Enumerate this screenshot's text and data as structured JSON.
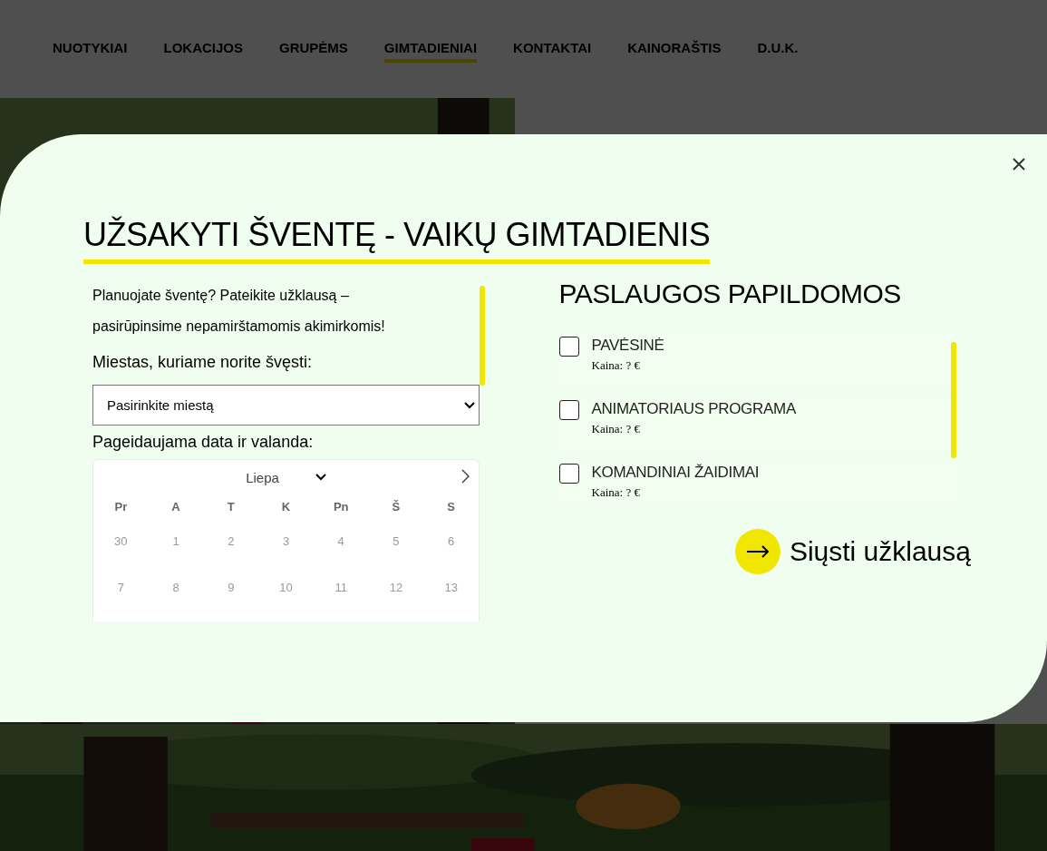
{
  "nav": {
    "items": [
      {
        "label": "NUOTYKIAI",
        "selected": false
      },
      {
        "label": "LOKACIJOS",
        "selected": false
      },
      {
        "label": "GRUPĖMS",
        "selected": false
      },
      {
        "label": "GIMTADIENIAI",
        "selected": true
      },
      {
        "label": "KONTAKTAI",
        "selected": false
      },
      {
        "label": "KAINORAŠTIS",
        "selected": false
      },
      {
        "label": "D.U.K.",
        "selected": false
      }
    ]
  },
  "modal": {
    "title": "UŽSAKYTI ŠVENTĘ - VAIKŲ GIMTADIENIS",
    "intro": [
      "Planuojate šventę? Pateikite užklausą –",
      "pasirūpinsime nepamirštamomis akimirkomis!"
    ],
    "city_label": "Miestas, kuriame norite švęsti:",
    "city_select": {
      "value": "Pasirinkite miestą"
    },
    "date_label": "Pageidaujama data ir valanda:",
    "calendar": {
      "month": "Liepa",
      "weekdays": [
        "Pr",
        "A",
        "T",
        "K",
        "Pn",
        "Š",
        "S"
      ],
      "weeks": [
        [
          {
            "day": "30",
            "disabled": true
          },
          {
            "day": "1",
            "disabled": true
          },
          {
            "day": "2",
            "disabled": true
          },
          {
            "day": "3",
            "disabled": true
          },
          {
            "day": "4",
            "disabled": true
          },
          {
            "day": "5",
            "disabled": true
          },
          {
            "day": "6",
            "disabled": true
          }
        ],
        [
          {
            "day": "7",
            "disabled": true
          },
          {
            "day": "8",
            "disabled": true
          },
          {
            "day": "9",
            "disabled": true
          },
          {
            "day": "10",
            "disabled": true
          },
          {
            "day": "11",
            "disabled": true
          },
          {
            "day": "12",
            "disabled": true
          },
          {
            "day": "13",
            "disabled": true
          }
        ]
      ]
    },
    "services_title": "PASLAUGOS PAPILDOMOS",
    "services": [
      {
        "name": "PAVĖSINĖ",
        "price": "Kaina: ? €",
        "checked": false
      },
      {
        "name": "ANIMATORIAUS PROGRAMA",
        "price": "Kaina: ? €",
        "checked": false
      },
      {
        "name": "KOMANDINIAI ŽAIDIMAI",
        "price": "Kaina: ? €",
        "checked": false
      }
    ],
    "submit": "Siųsti užklausą"
  }
}
